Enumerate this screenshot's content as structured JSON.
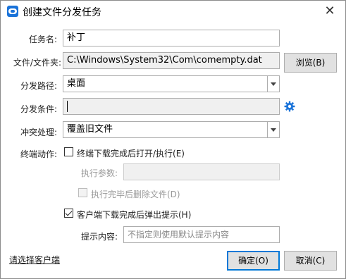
{
  "window": {
    "title": "创建文件分发任务",
    "close_glyph": "✕"
  },
  "form": {
    "task_name": {
      "label": "任务名:",
      "value": "补丁"
    },
    "file": {
      "label": "文件/文件夹:",
      "value": "C:\\Windows\\System32\\Com\\comempty.dat",
      "browse_label": "浏览(B)"
    },
    "dist_path": {
      "label": "分发路径:",
      "value": "桌面"
    },
    "dist_condition": {
      "label": "分发条件:",
      "value": ""
    },
    "conflict": {
      "label": "冲突处理:",
      "value": "覆盖旧文件"
    },
    "post_action": {
      "label": "终端动作:",
      "open_after_download": {
        "label": "终端下载完成后打开/执行(E)",
        "checked": false
      },
      "exec_params": {
        "label": "执行参数:",
        "value": ""
      },
      "delete_after_exec": {
        "label": "执行完毕后删除文件(D)",
        "checked": false
      },
      "popup_prompt": {
        "label": "客户端下载完成后弹出提示(H)",
        "checked": true
      },
      "prompt_content": {
        "label": "提示内容:",
        "placeholder": "不指定则使用默认提示内容"
      }
    }
  },
  "footer": {
    "select_clients_link": "请选择客户端",
    "ok_label": "确定(O)",
    "cancel_label": "取消(C)"
  },
  "colors": {
    "accent": "#0078d7",
    "gear": "#1a73d9"
  },
  "icons": {
    "app": "teamviewer-app-icon",
    "settings": "gear-icon",
    "close": "close-icon",
    "dropdown": "chevron-down-icon"
  }
}
